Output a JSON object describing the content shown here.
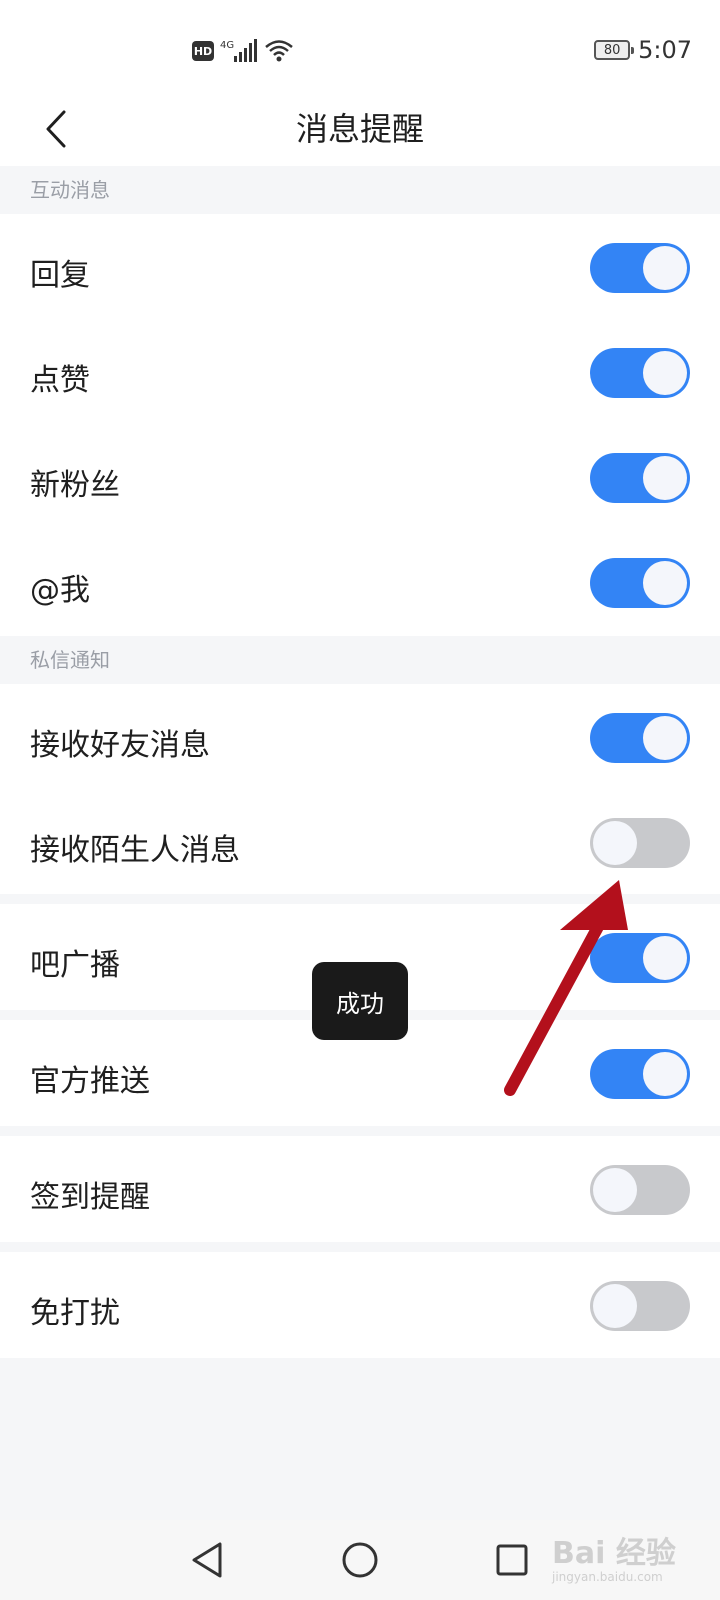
{
  "status_bar": {
    "hd": "HD",
    "network": "4G",
    "battery": "80",
    "time": "5:07"
  },
  "header": {
    "title": "消息提醒",
    "back_icon": "chevron-left-icon"
  },
  "sections": [
    {
      "title": "互动消息",
      "items": [
        {
          "label": "回复",
          "on": true
        },
        {
          "label": "点赞",
          "on": true
        },
        {
          "label": "新粉丝",
          "on": true
        },
        {
          "label": "@我",
          "on": true
        }
      ]
    },
    {
      "title": "私信通知",
      "items": [
        {
          "label": "接收好友消息",
          "on": true
        },
        {
          "label": "接收陌生人消息",
          "on": false
        }
      ]
    }
  ],
  "standalone_items": [
    {
      "label": "吧广播",
      "on": true
    },
    {
      "label": "官方推送",
      "on": true
    },
    {
      "label": "签到提醒",
      "on": false
    },
    {
      "label": "免打扰",
      "on": false
    }
  ],
  "toast": {
    "text": "成功"
  },
  "nav": {
    "back": "triangle-back-icon",
    "home": "circle-home-icon",
    "recents": "square-recents-icon"
  },
  "watermark": {
    "brand": "Bai 经验",
    "url": "jingyan.baidu.com"
  },
  "colors": {
    "toggle_on": "#3384f5",
    "toggle_off": "#c8c9cc",
    "annotation_arrow": "#b3101c"
  }
}
